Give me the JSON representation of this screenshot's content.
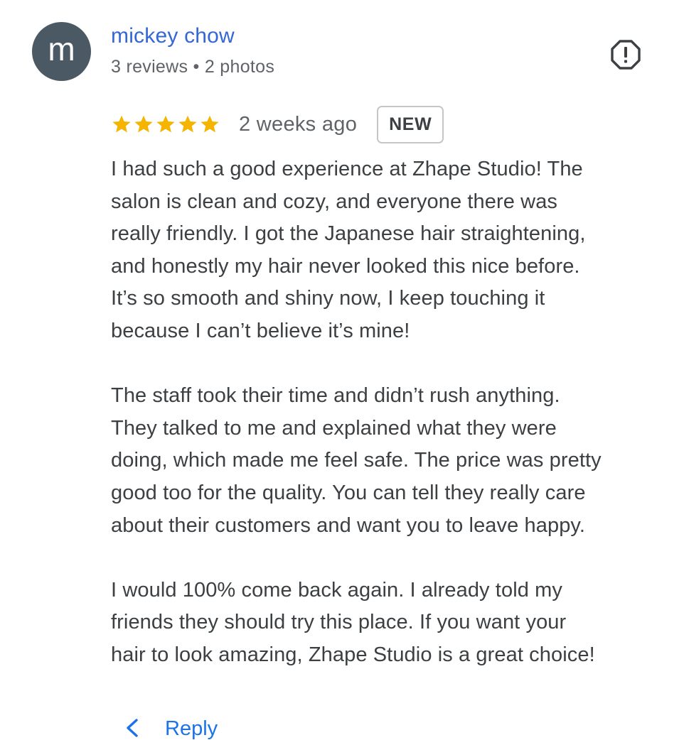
{
  "reviewer": {
    "avatar_letter": "m",
    "avatar_color": "#4a5963",
    "name": "mickey chow",
    "meta": "3 reviews • 2 photos"
  },
  "rating": {
    "stars": 5,
    "max_stars": 5,
    "star_color": "#f4b400",
    "time": "2 weeks ago",
    "badge": "NEW"
  },
  "review": {
    "paragraphs": [
      "I had such a good experience at Zhape Studio! The\nsalon is clean and cozy, and everyone there was\nreally friendly. I got the Japanese hair straightening,\nand honestly my hair never looked this nice before.\nIt’s so smooth and shiny now, I keep touching it\nbecause I can’t believe it’s mine!",
      "The staff took their time and didn’t rush anything.\nThey talked to me and explained what they were\ndoing, which made me feel safe. The price was pretty\ngood too for the quality. You can tell they really care\nabout their customers and want you to leave happy.",
      "I would 100% come back again. I already told my\nfriends they should try this place. If you want your\nhair to look amazing, Zhape Studio is a great choice!"
    ]
  },
  "actions": {
    "report_icon": "report-icon",
    "reply_icon": "reply-arrow-icon",
    "reply_label": "Reply"
  },
  "colors": {
    "link": "#3367d6",
    "accent": "#1a73e8",
    "text": "#3c4043",
    "secondary_text": "#5f6368"
  }
}
